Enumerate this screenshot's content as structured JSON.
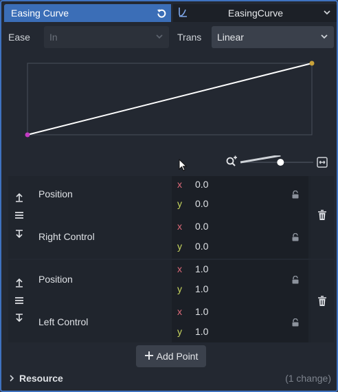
{
  "header": {
    "property_name": "Easing Curve",
    "resource_name": "EasingCurve"
  },
  "ease": {
    "label": "Ease",
    "value": "In",
    "disabled": true
  },
  "trans": {
    "label": "Trans",
    "value": "Linear"
  },
  "curve": {
    "start": {
      "x": 0.0,
      "y": 0.0
    },
    "end": {
      "x": 1.0,
      "y": 1.0
    },
    "start_color": "#c23bc2",
    "end_color": "#c9a23a"
  },
  "points": [
    {
      "position_label": "Position",
      "control_label": "Right Control",
      "position": {
        "x": "0.0",
        "y": "0.0"
      },
      "control": {
        "x": "0.0",
        "y": "0.0"
      }
    },
    {
      "position_label": "Position",
      "control_label": "Left Control",
      "position": {
        "x": "1.0",
        "y": "1.0"
      },
      "control": {
        "x": "1.0",
        "y": "1.0"
      }
    }
  ],
  "axis_x": "x",
  "axis_y": "y",
  "add_point_label": "Add Point",
  "resource": {
    "label": "Resource",
    "changes": "(1 change)"
  },
  "zoom": {
    "level": 0.55
  },
  "colors": {
    "accent": "#3b6eb7",
    "x_axis": "#e26b7a",
    "y_axis": "#c9d75f"
  }
}
